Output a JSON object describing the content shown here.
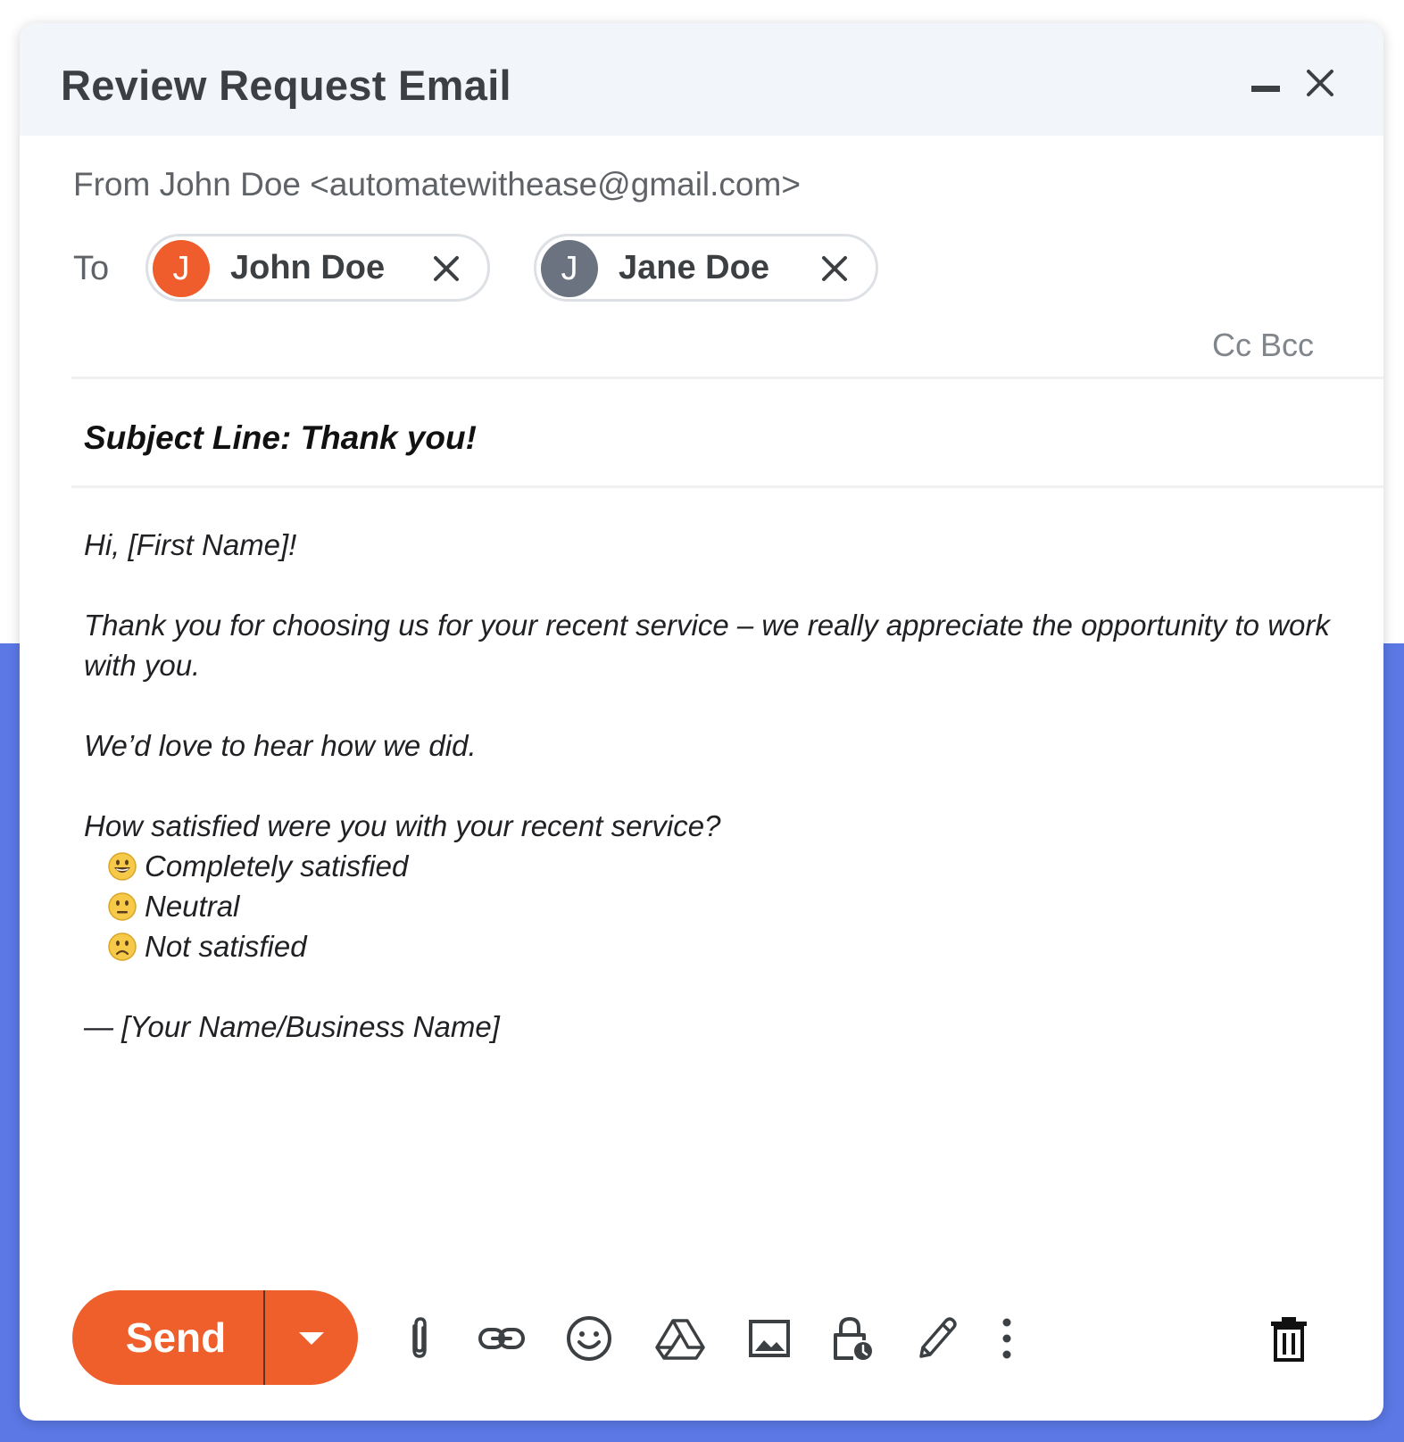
{
  "window": {
    "title": "Review Request Email"
  },
  "header": {
    "from": "From John Doe <automatewithease@gmail.com>",
    "to_label": "To",
    "recipients": [
      {
        "initial": "J",
        "name": "John Doe",
        "avatar_color": "#ee5d2b"
      },
      {
        "initial": "J",
        "name": "Jane Doe",
        "avatar_color": "#6b7280"
      }
    ],
    "cc_bcc": "Cc Bcc"
  },
  "subject": "Subject Line: Thank you!",
  "body": {
    "greeting": "Hi, [First Name]!",
    "paragraph1": "Thank you for choosing us for your recent service – we really appreciate the opportunity to work with you.",
    "paragraph2": "We’d love to hear how we did.",
    "question": "How satisfied were you with your recent service?",
    "options": [
      {
        "icon": "grinning-face-emoji",
        "label": "Completely satisfied"
      },
      {
        "icon": "neutral-face-emoji",
        "label": "Neutral"
      },
      {
        "icon": "frowning-face-emoji",
        "label": "Not satisfied"
      }
    ],
    "signature": "— [Your Name/Business Name]"
  },
  "toolbar": {
    "send_label": "Send",
    "tools": [
      "attach-icon",
      "link-icon",
      "emoji-icon",
      "drive-icon",
      "image-icon",
      "confidential-mode-icon",
      "signature-icon",
      "more-options-icon"
    ],
    "trash": "trash-icon"
  },
  "colors": {
    "accent": "#ef5f2c",
    "backdrop": "#5b78e5",
    "titlebar": "#f2f5fa",
    "icon": "#3c4043"
  }
}
